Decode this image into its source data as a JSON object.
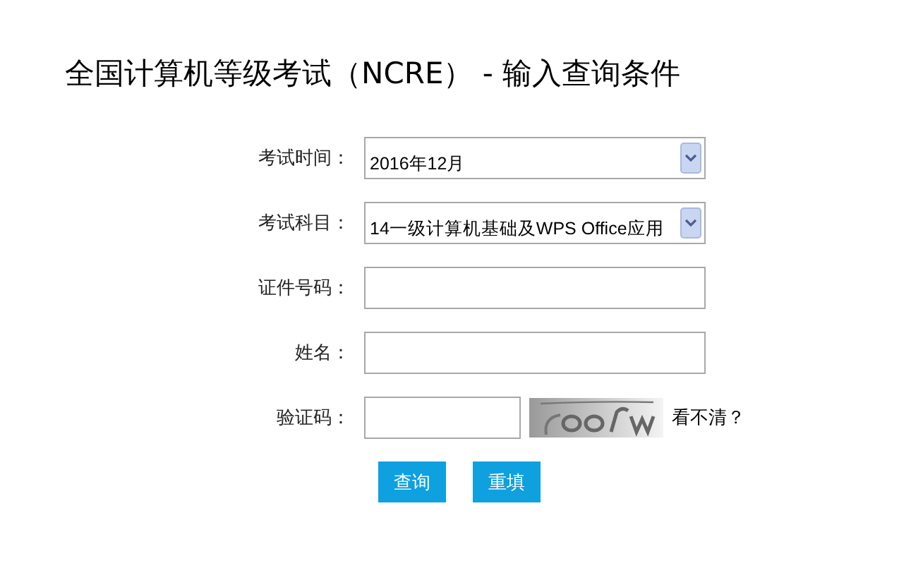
{
  "title": "全国计算机等级考试（NCRE） - 输入查询条件",
  "fields": [
    {
      "kind": "select",
      "label": "考试时间：",
      "value": "2016年12月"
    },
    {
      "kind": "select",
      "label": "考试科目：",
      "value": "14一级计算机基础及WPS Office应用"
    },
    {
      "kind": "text",
      "label": "证件号码："
    },
    {
      "kind": "text",
      "label": "姓名："
    },
    {
      "kind": "captcha",
      "label": "验证码：",
      "link": "看不清？"
    }
  ],
  "buttons": [
    "查询",
    "重填"
  ]
}
